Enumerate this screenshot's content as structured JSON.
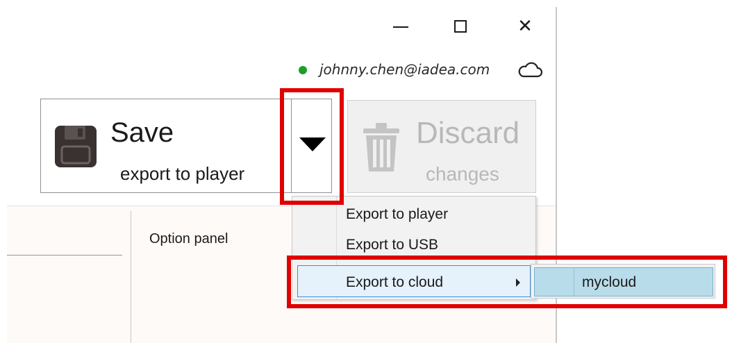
{
  "window": {
    "controls": {
      "minimize_icon": "minimize-icon",
      "maximize_icon": "maximize-icon",
      "close_glyph": "✕"
    }
  },
  "account": {
    "email": "johnny.chen@iadea.com",
    "status_color": "#1e9e2a",
    "cloud_icon": "cloud-icon"
  },
  "toolbar": {
    "save": {
      "title": "Save",
      "subtitle": "export to player",
      "icon": "floppy-disk-icon"
    },
    "discard": {
      "title": "Discard",
      "subtitle": "changes",
      "icon": "trash-icon",
      "enabled": false
    }
  },
  "panel": {
    "option_label": "Option panel"
  },
  "export_menu": {
    "items": [
      {
        "label": "Export to player"
      },
      {
        "label": "Export to USB"
      },
      {
        "label": "Export to cloud",
        "has_submenu": true,
        "highlighted": true
      }
    ],
    "submenu": {
      "items": [
        {
          "label": "mycloud",
          "highlighted": true
        }
      ]
    }
  },
  "highlight_color": "#e00000"
}
